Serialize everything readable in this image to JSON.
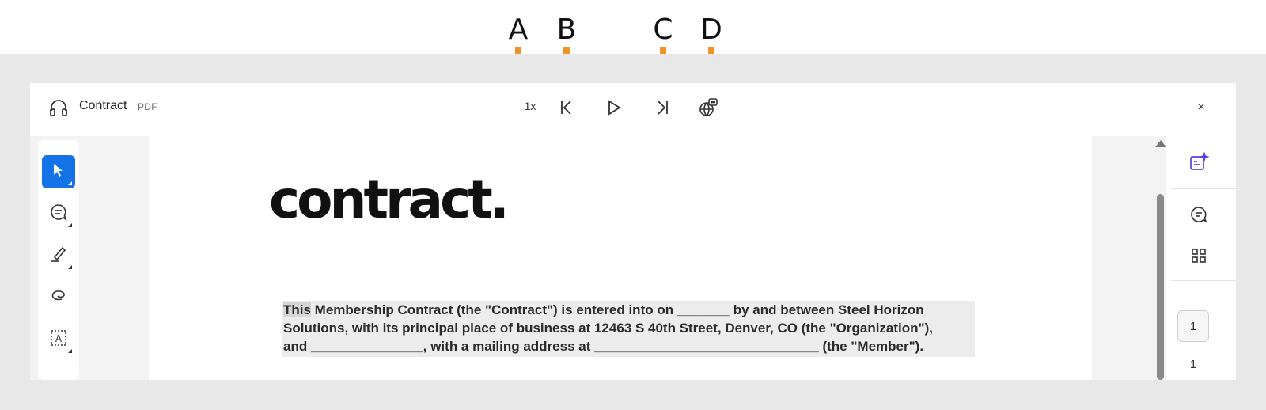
{
  "callouts": [
    "A",
    "B",
    "C",
    "D"
  ],
  "header": {
    "title": "Contract",
    "file_type": "PDF",
    "speed_label": "1x",
    "close_label": "×",
    "icons": {
      "listen": "headphones-icon",
      "previous": "skip-back-icon",
      "play": "play-icon",
      "next": "skip-forward-icon",
      "voice": "globe-chat-icon"
    }
  },
  "tools": [
    "select-cursor-icon",
    "comment-icon",
    "highlight-pen-icon",
    "lasso-draw-icon",
    "text-box-icon"
  ],
  "document": {
    "logo": "contract.",
    "paragraph": {
      "highlighted_word": "This",
      "line1_rest": " Membership Contract (the \"Contract\") is entered into on _______ by and between Steel Horizon",
      "line2": "Solutions, with its principal place of business at 12463 S 40th Street, Denver, CO (the \"Organization\"),",
      "line3": "and _______________, with a mailing address at ______________________________ (the \"Member\")."
    }
  },
  "right_rail": {
    "icons": [
      "ai-assistant-icon",
      "comments-panel-icon",
      "thumbnails-grid-icon"
    ],
    "current_page": "1",
    "total_pages": "1"
  },
  "colors": {
    "accent": "#1473e6",
    "callout_line": "#f0942a",
    "ai_icon": "#5b3fd6"
  }
}
